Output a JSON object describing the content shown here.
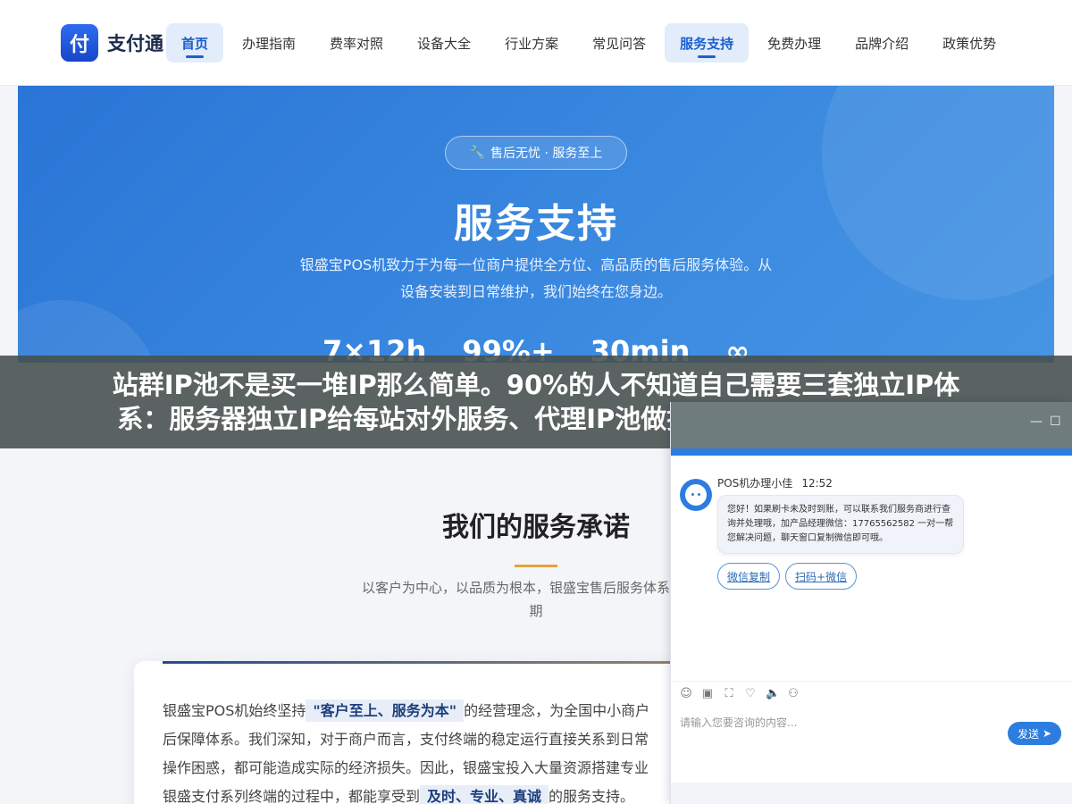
{
  "header": {
    "logo_mark": "付",
    "logo_text": "支付通",
    "nav": [
      {
        "label": "首页",
        "active": true
      },
      {
        "label": "办理指南",
        "active": false
      },
      {
        "label": "费率对照",
        "active": false
      },
      {
        "label": "设备大全",
        "active": false
      },
      {
        "label": "行业方案",
        "active": false
      },
      {
        "label": "常见问答",
        "active": false
      },
      {
        "label": "服务支持",
        "active": true
      },
      {
        "label": "免费办理",
        "active": false
      },
      {
        "label": "品牌介绍",
        "active": false
      },
      {
        "label": "政策优势",
        "active": false
      }
    ]
  },
  "hero": {
    "badge": "售后无忧 · 服务至上",
    "title": "服务支持",
    "desc": "银盛宝POS机致力于为每一位商户提供全方位、高品质的售后服务体验。从设备安装到日常维护，我们始终在您身边。",
    "stats": [
      "7×12h",
      "99%+",
      "30min",
      "∞"
    ]
  },
  "promise": {
    "title": "我们的服务承诺",
    "subtitle": "以客户为中心，以品质为根本，银盛宝售后服务体系全面覆",
    "subtitle_tail": "期",
    "card": {
      "p1_before": "银盛宝POS机始终坚持",
      "p1_highlight": "\"客户至上、服务为本\"",
      "p1_after": "的经营理念，为全国中小商户",
      "line2": "后保障体系。我们深知，对于商户而言，支付终端的稳定运行直接关系到日常",
      "line3": "操作困惑，都可能造成实际的经济损失。因此，银盛宝投入大量资源搭建专业",
      "line4_before": "银盛支付系列终端的过程中，都能享受到",
      "line4_highlight": "及时、专业、真诚",
      "line4_after": "的服务支持。"
    }
  },
  "banner": {
    "line1": "站群IP池不是买一堆IP那么简单。90%的人不知道自己需要三套独立IP体",
    "line2": "系：服务器独立IP给每站对外服务、代理IP池做批量管理防关联、CDN I"
  },
  "chat": {
    "minimize": "—",
    "maximize": "☐",
    "agent_name": "POS机办理小佳",
    "time": "12:52",
    "message": "您好！如果刷卡未及时到账，可以联系我们服务商进行查询并处理哦，加产品经理微信：17765562582 一对一帮您解决问题，聊天窗口复制微信即可哦。",
    "quick_buttons": [
      "微信复制",
      "扫码+微信"
    ],
    "tools": [
      "☺",
      "▣",
      "⛶",
      "♡",
      "🔈",
      "⚇"
    ],
    "input_placeholder": "请输入您要咨询的内容...",
    "send_label": "发送"
  }
}
